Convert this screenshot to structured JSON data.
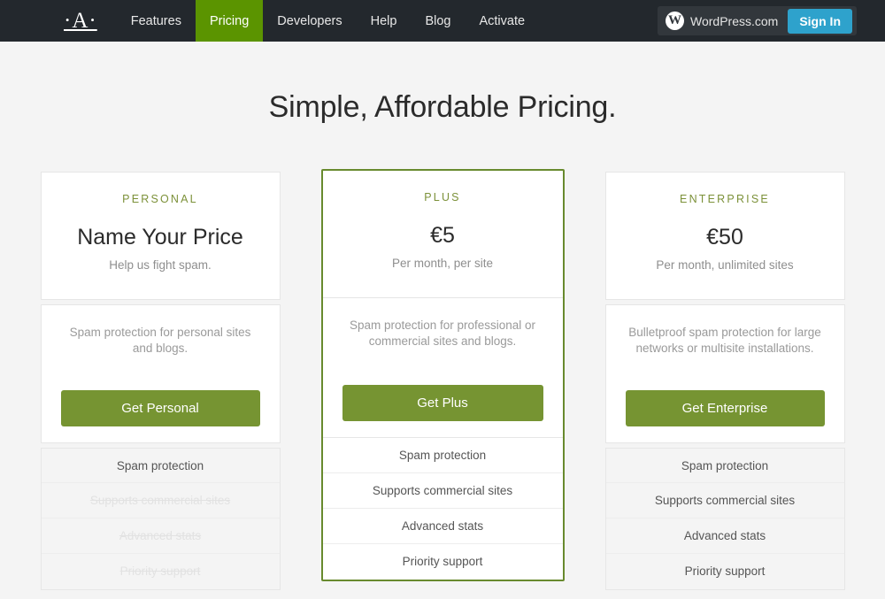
{
  "navbar": {
    "logo": "·A·",
    "links": [
      {
        "label": "Features",
        "active": false
      },
      {
        "label": "Pricing",
        "active": true
      },
      {
        "label": "Developers",
        "active": false
      },
      {
        "label": "Help",
        "active": false
      },
      {
        "label": "Blog",
        "active": false
      },
      {
        "label": "Activate",
        "active": false
      }
    ],
    "wordpress_mark": "W",
    "wordpress_label": "WordPress.com",
    "signin_label": "Sign In",
    "bg_color": "#23282d",
    "active_color": "#5b9400",
    "signin_color": "#2ea2cc"
  },
  "page": {
    "title": "Simple, Affordable Pricing."
  },
  "plans": [
    {
      "name": "PERSONAL",
      "price": "Name Your Price",
      "sub": "Help us fight spam.",
      "description": "Spam protection for personal sites and blogs.",
      "cta": "Get Personal",
      "featured": false,
      "features": [
        {
          "label": "Spam protection",
          "enabled": true
        },
        {
          "label": "Supports commercial sites",
          "enabled": false
        },
        {
          "label": "Advanced stats",
          "enabled": false
        },
        {
          "label": "Priority support",
          "enabled": false
        }
      ]
    },
    {
      "name": "PLUS",
      "price": "€5",
      "sub": "Per month, per site",
      "description": "Spam protection for professional or commercial sites and blogs.",
      "cta": "Get Plus",
      "featured": true,
      "features": [
        {
          "label": "Spam protection",
          "enabled": true
        },
        {
          "label": "Supports commercial sites",
          "enabled": true
        },
        {
          "label": "Advanced stats",
          "enabled": true
        },
        {
          "label": "Priority support",
          "enabled": true
        }
      ]
    },
    {
      "name": "ENTERPRISE",
      "price": "€50",
      "sub": "Per month, unlimited sites",
      "description": "Bulletproof spam protection for large networks or multisite installations.",
      "cta": "Get Enterprise",
      "featured": false,
      "features": [
        {
          "label": "Spam protection",
          "enabled": true
        },
        {
          "label": "Supports commercial sites",
          "enabled": true
        },
        {
          "label": "Advanced stats",
          "enabled": true
        },
        {
          "label": "Priority support",
          "enabled": true
        }
      ]
    }
  ],
  "theme": {
    "page_bg": "#f4f4f4",
    "card_bg": "#ffffff",
    "accent_green": "#769432",
    "plan_name_green": "#7c9139",
    "featured_border": "#688a2e"
  }
}
